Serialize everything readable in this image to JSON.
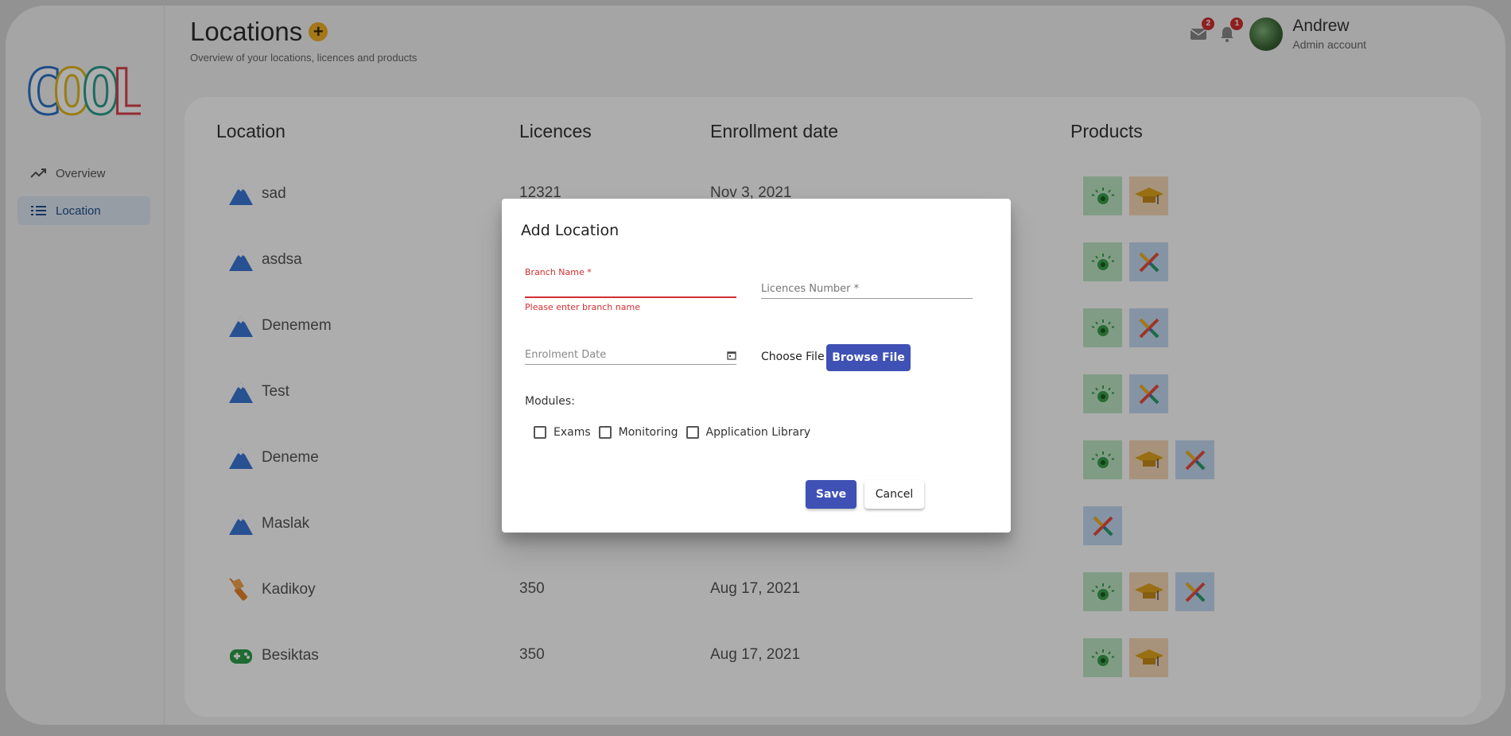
{
  "app": {
    "logo_text": "COOL"
  },
  "sidebar": {
    "items": [
      {
        "label": "Overview",
        "icon": "trending-up-icon",
        "active": false
      },
      {
        "label": "Location",
        "icon": "list-icon",
        "active": true
      }
    ]
  },
  "header": {
    "title": "Locations",
    "subtitle": "Overview of your locations, licences and products",
    "user": {
      "name": "Andrew",
      "role": "Admin account"
    },
    "mail_count": "2",
    "notification_count": "1"
  },
  "table": {
    "columns": [
      "Location",
      "Licences",
      "Enrollment date",
      "Products"
    ],
    "rows": [
      {
        "name": "sad",
        "licences": "12321",
        "date": "Nov 3, 2021",
        "icon": "mountain-icon",
        "products": [
          "eye",
          "cap"
        ]
      },
      {
        "name": "asdsa",
        "licences": "",
        "date": "",
        "icon": "mountain-icon",
        "products": [
          "eye",
          "cross"
        ]
      },
      {
        "name": "Denemem",
        "licences": "",
        "date": "",
        "icon": "mountain-icon",
        "products": [
          "eye",
          "cross"
        ]
      },
      {
        "name": "Test",
        "licences": "",
        "date": "",
        "icon": "mountain-icon",
        "products": [
          "eye",
          "cross"
        ]
      },
      {
        "name": "Deneme",
        "licences": "",
        "date": "",
        "icon": "mountain-icon",
        "products": [
          "eye",
          "cap",
          "cross"
        ]
      },
      {
        "name": "Maslak",
        "licences": "",
        "date": "",
        "icon": "mountain-icon",
        "products": [
          "cross"
        ]
      },
      {
        "name": "Kadikoy",
        "licences": "350",
        "date": "Aug 17, 2021",
        "icon": "flashlight-icon",
        "products": [
          "eye",
          "cap",
          "cross"
        ]
      },
      {
        "name": "Besiktas",
        "licences": "350",
        "date": "Aug 17, 2021",
        "icon": "gamepad-icon",
        "products": [
          "eye",
          "cap"
        ]
      }
    ]
  },
  "dialog": {
    "title": "Add Location",
    "branch_label": "Branch Name *",
    "branch_value": "",
    "branch_error": "Please enter branch name",
    "licences_placeholder": "Licences Number *",
    "enrolment_placeholder": "Enrolment Date",
    "choose_file_label": "Choose File",
    "browse_label": "Browse File",
    "modules_label": "Modules:",
    "modules": [
      "Exams",
      "Monitoring",
      "Application Library"
    ],
    "save_label": "Save",
    "cancel_label": "Cancel"
  },
  "colors": {
    "primary": "#3f51b5",
    "error": "#d32f2f",
    "accent": "#f0b129",
    "nav_active_bg": "#dde8f4"
  }
}
